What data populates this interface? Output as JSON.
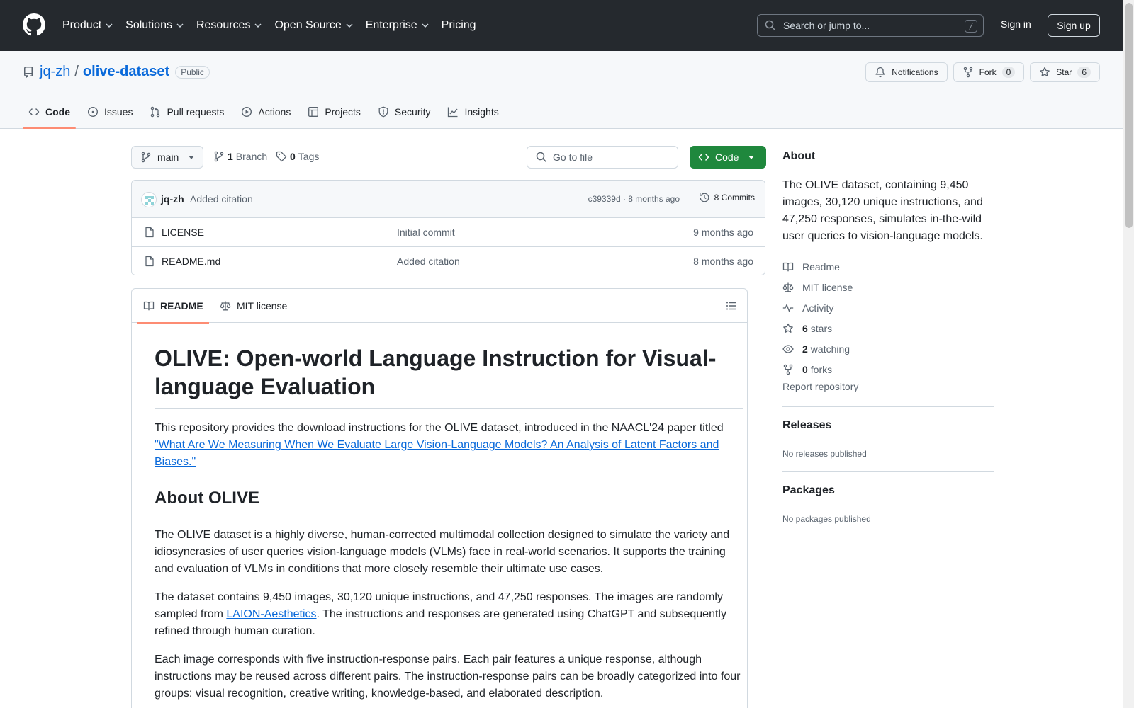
{
  "header": {
    "nav": [
      {
        "label": "Product",
        "dropdown": true
      },
      {
        "label": "Solutions",
        "dropdown": true
      },
      {
        "label": "Resources",
        "dropdown": true
      },
      {
        "label": "Open Source",
        "dropdown": true
      },
      {
        "label": "Enterprise",
        "dropdown": true
      },
      {
        "label": "Pricing",
        "dropdown": false
      }
    ],
    "search_placeholder": "Search or jump to...",
    "search_shortcut": "/",
    "sign_in": "Sign in",
    "sign_up": "Sign up"
  },
  "repo": {
    "owner": "jq-zh",
    "separator": "/",
    "name": "olive-dataset",
    "visibility": "Public",
    "notifications_label": "Notifications",
    "fork_label": "Fork",
    "fork_count": "0",
    "star_label": "Star",
    "star_count": "6"
  },
  "tabs": [
    "Code",
    "Issues",
    "Pull requests",
    "Actions",
    "Projects",
    "Security",
    "Insights"
  ],
  "file_nav": {
    "branch": "main",
    "branch_count": "1",
    "branch_label": "Branch",
    "tag_count": "0",
    "tag_label": "Tags",
    "goto_placeholder": "Go to file",
    "code_button": "Code"
  },
  "latest_commit": {
    "author": "jq-zh",
    "message": "Added citation",
    "hash_time": "c39339d · 8 months ago",
    "commits_label": "8 Commits"
  },
  "files": [
    {
      "name": "LICENSE",
      "commit": "Initial commit",
      "age": "9 months ago"
    },
    {
      "name": "README.md",
      "commit": "Added citation",
      "age": "8 months ago"
    }
  ],
  "readme": {
    "tab_readme": "README",
    "tab_license": "MIT license",
    "title": "OLIVE: Open-world Language Instruction for Visual-language Evaluation",
    "intro": "This repository provides the download instructions for the OLIVE dataset, introduced in the NAACL'24 paper titled",
    "paper_link": "\"What Are We Measuring When We Evaluate Large Vision-Language Models? An Analysis of Latent Factors and Biases.\"",
    "about_heading": "About OLIVE",
    "p1": "The OLIVE dataset is a highly diverse, human-corrected multimodal collection designed to simulate the variety and idiosyncrasies of user queries vision-language models (VLMs) face in real-world scenarios. It supports the training and evaluation of VLMs in conditions that more closely resemble their ultimate use cases.",
    "p2_a": "The dataset contains 9,450 images, 30,120 unique instructions, and 47,250 responses. The images are randomly sampled from ",
    "p2_link": "LAION-Aesthetics",
    "p2_b": ". The instructions and responses are generated using ChatGPT and subsequently refined through human curation.",
    "p3": "Each image corresponds with five instruction-response pairs. Each pair features a unique response, although instructions may be reused across different pairs. The instruction-response pairs can be broadly categorized into four groups: visual recognition, creative writing, knowledge-based, and elaborated description."
  },
  "sidebar": {
    "about_heading": "About",
    "description": "The OLIVE dataset, containing 9,450 images, 30,120 unique instructions, and 47,250 responses, simulates in-the-wild user queries to vision-language models.",
    "readme": "Readme",
    "license": "MIT license",
    "activity": "Activity",
    "stars_count": "6",
    "stars_label": "stars",
    "watching_count": "2",
    "watching_label": "watching",
    "forks_count": "0",
    "forks_label": "forks",
    "report": "Report repository",
    "releases_heading": "Releases",
    "releases_none": "No releases published",
    "packages_heading": "Packages",
    "packages_none": "No packages published"
  }
}
